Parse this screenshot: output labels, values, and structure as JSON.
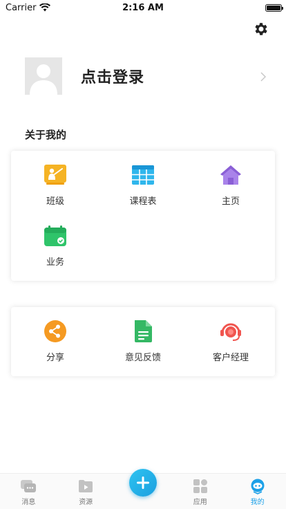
{
  "status_bar": {
    "carrier": "Carrier",
    "time": "2:16 AM"
  },
  "profile": {
    "login_text": "点击登录"
  },
  "about_section": {
    "title": "关于我的",
    "items": [
      {
        "label": "班级",
        "icon": "class-icon"
      },
      {
        "label": "课程表",
        "icon": "schedule-icon"
      },
      {
        "label": "主页",
        "icon": "home-icon"
      },
      {
        "label": "业务",
        "icon": "business-icon"
      }
    ]
  },
  "more_section": {
    "items": [
      {
        "label": "分享",
        "icon": "share-icon"
      },
      {
        "label": "意见反馈",
        "icon": "feedback-icon"
      },
      {
        "label": "客户经理",
        "icon": "account-manager-icon"
      }
    ]
  },
  "tabbar": {
    "tabs": [
      {
        "label": "消息",
        "icon": "message-icon"
      },
      {
        "label": "资源",
        "icon": "resource-icon"
      },
      {
        "label": "应用",
        "icon": "apps-icon"
      },
      {
        "label": "我的",
        "icon": "mine-icon",
        "active": true
      }
    ]
  },
  "colors": {
    "accent": "#1da1e8",
    "class_icon": "#f5b324",
    "schedule_icon": "#2fb6ec",
    "home_icon": "#9a6fe0",
    "business_icon": "#2fc46a",
    "share_icon": "#f59a22",
    "feedback_icon": "#34b864",
    "manager_icon": "#f0554f"
  }
}
